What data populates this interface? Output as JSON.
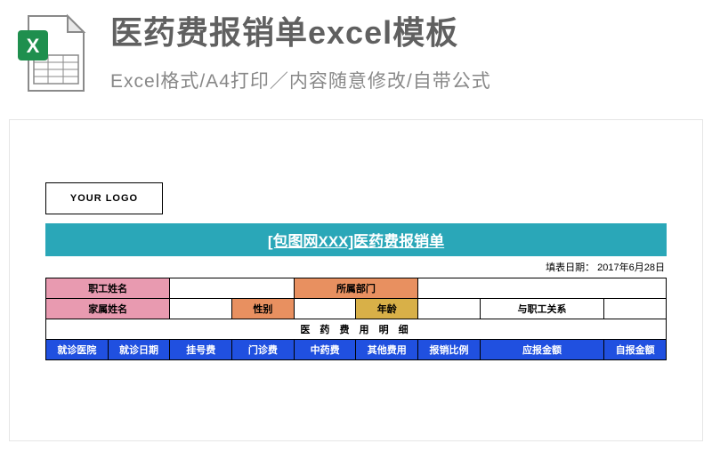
{
  "header": {
    "title": "医药费报销单excel模板",
    "subtitle": "Excel格式/A4打印／内容随意修改/自带公式",
    "icon_letter": "X"
  },
  "sheet": {
    "logo_text": "YOUR LOGO",
    "banner": "[包图网XXX]医药费报销单",
    "fill_date_label": "填表日期：",
    "fill_date_value": "2017年6月28日",
    "row1": {
      "emp_name_label": "职工姓名",
      "dept_label": "所属部门"
    },
    "row2": {
      "family_name_label": "家属姓名",
      "gender_label": "性别",
      "age_label": "年龄",
      "relation_label": "与职工关系"
    },
    "detail_title": "医 药 费 用 明 细",
    "detail_headers": [
      "就诊医院",
      "就诊日期",
      "挂号费",
      "门诊费",
      "中药费",
      "其他费用",
      "报销比例",
      "应报金额",
      "自报金额"
    ]
  }
}
